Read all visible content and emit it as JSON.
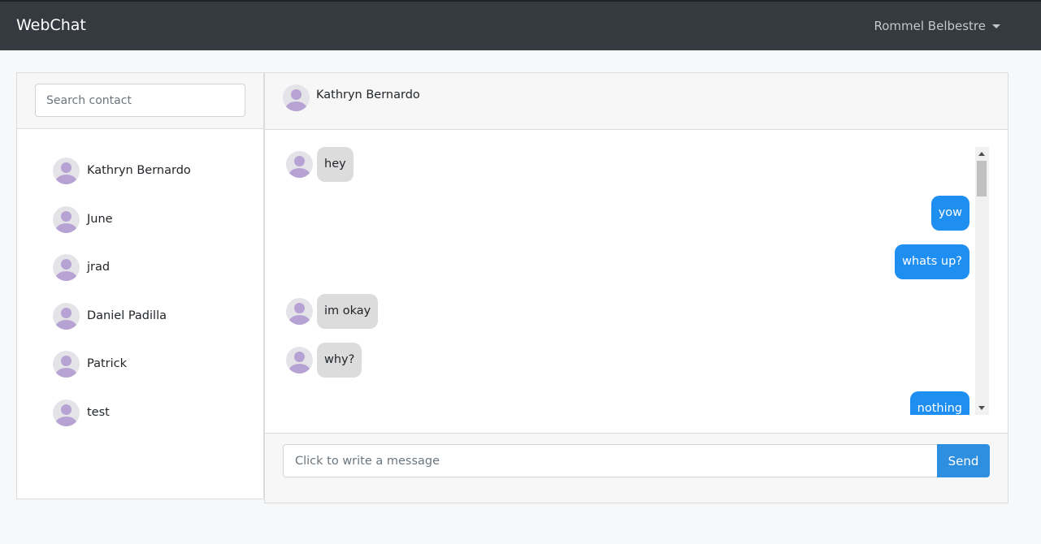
{
  "navbar": {
    "brand": "WebChat",
    "user_name": "Rommel Belbestre"
  },
  "contacts": {
    "search_placeholder": "Search contact",
    "items": [
      {
        "name": "Kathryn Bernardo"
      },
      {
        "name": "June"
      },
      {
        "name": "jrad"
      },
      {
        "name": "Daniel Padilla"
      },
      {
        "name": "Patrick"
      },
      {
        "name": "test"
      }
    ]
  },
  "chat": {
    "title": "Kathryn Bernardo",
    "messages": [
      {
        "direction": "in",
        "text": "hey"
      },
      {
        "direction": "out",
        "text": "yow"
      },
      {
        "direction": "out",
        "text": "whats up?"
      },
      {
        "direction": "in",
        "text": "im okay"
      },
      {
        "direction": "in",
        "text": "why?"
      },
      {
        "direction": "out",
        "text": "nothing"
      }
    ],
    "input_placeholder": "Click to write a message",
    "send_label": "Send"
  },
  "colors": {
    "navbar": "#343a40",
    "outgoing_bubble": "#1f8ef1",
    "incoming_bubble": "#dcdcdc",
    "send_button": "#2e8fe0",
    "avatar_figure": "#b6a2d3"
  },
  "icons": {
    "user_menu_caret": "caret-down-icon",
    "avatar": "user-avatar-icon"
  }
}
